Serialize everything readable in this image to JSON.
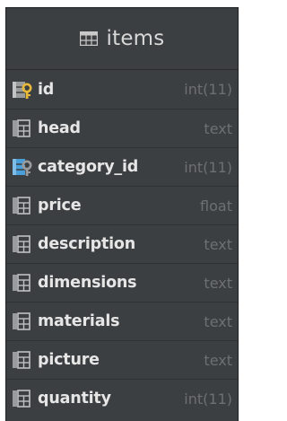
{
  "table": {
    "name": "items",
    "icon": "table-grid-icon"
  },
  "columns": [
    {
      "name": "id",
      "type": "int(11)",
      "icon": "primary-key-column-icon"
    },
    {
      "name": "head",
      "type": "text",
      "icon": "column-icon"
    },
    {
      "name": "category_id",
      "type": "int(11)",
      "icon": "foreign-key-column-icon"
    },
    {
      "name": "price",
      "type": "float",
      "icon": "column-icon"
    },
    {
      "name": "description",
      "type": "text",
      "icon": "column-icon"
    },
    {
      "name": "dimensions",
      "type": "text",
      "icon": "column-icon"
    },
    {
      "name": "materials",
      "type": "text",
      "icon": "column-icon"
    },
    {
      "name": "picture",
      "type": "text",
      "icon": "column-icon"
    },
    {
      "name": "quantity",
      "type": "int(11)",
      "icon": "column-icon"
    }
  ],
  "colors": {
    "panel_background": "#3c3f41",
    "column_name_text": "#e6e6e6",
    "column_type_text": "#6d7073",
    "primary_key_gold": "#e8b83a",
    "foreign_key_blue": "#4a9fd8",
    "column_icon_gray": "#a9aaab"
  }
}
